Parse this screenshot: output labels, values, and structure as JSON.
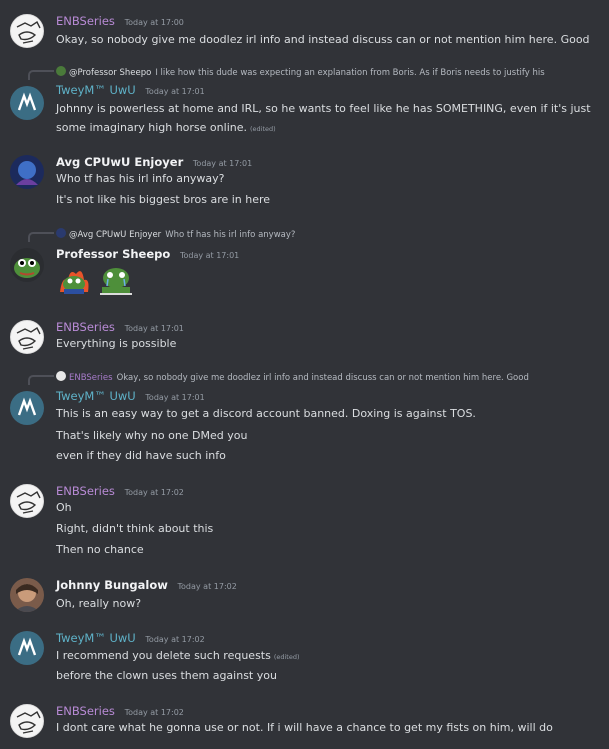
{
  "messages": [
    {
      "author": "ENBSeries",
      "time": "Today at 17:00",
      "lines": [
        "Okay, so nobody give me doodlez irl info and instead discuss can or not mention him here. Good"
      ]
    },
    {
      "reply": {
        "author": "@Professor Sheepo",
        "text": "I like how this dude was expecting an explanation from Boris. As if Boris needs to justify his"
      },
      "author": "TweyM™ UwU",
      "time": "Today at 17:01",
      "lines": [
        "Johnny is powerless at home and IRL, so he wants to feel like he has SOMETHING, even if it's just",
        "some imaginary high horse online."
      ],
      "edited": "(edited)"
    },
    {
      "author": "Avg CPUwU Enjoyer",
      "time": "Today at 17:01",
      "lines": [
        "Who tf has his irl info anyway?",
        "It's not like his biggest bros are in here"
      ]
    },
    {
      "reply": {
        "author": "@Avg CPUwU Enjoyer",
        "text": "Who tf has his irl info anyway?"
      },
      "author": "Professor Sheepo",
      "time": "Today at 17:01",
      "stickers": [
        "pepe-fire-sticker",
        "pepe-crying-sticker"
      ]
    },
    {
      "author": "ENBSeries",
      "time": "Today at 17:01",
      "lines": [
        "Everything is possible"
      ]
    },
    {
      "reply": {
        "author": "ENBSeries",
        "text": "Okay, so nobody give me doodlez irl info and instead discuss can or not mention him here. Good"
      },
      "author": "TweyM™ UwU",
      "time": "Today at 17:01",
      "lines": [
        "This is an easy way to get a discord account banned. Doxing is against TOS.",
        "That's likely why no one DMed you",
        "even if they did have such info"
      ]
    },
    {
      "author": "ENBSeries",
      "time": "Today at 17:02",
      "lines": [
        "Oh",
        "Right, didn't think about this",
        "Then no chance"
      ]
    },
    {
      "author": "Johnny Bungalow",
      "time": "Today at 17:02",
      "lines": [
        "Oh, really now?"
      ]
    },
    {
      "author": "TweyM™ UwU",
      "time": "Today at 17:02",
      "lines": [
        "I recommend you delete such requests",
        "before the clown uses them against you"
      ],
      "edited": "(edited)"
    },
    {
      "author": "ENBSeries",
      "time": "Today at 17:02",
      "lines": [
        "I dont care what he gonna use or not. If i will have a chance to get my fists on him, will do"
      ]
    }
  ],
  "colors": {
    "background": "#313338",
    "enb_name": "#b98bd6",
    "twey_name": "#5fb3c9",
    "text": "#dbdee1",
    "timestamp": "#949ba4"
  }
}
